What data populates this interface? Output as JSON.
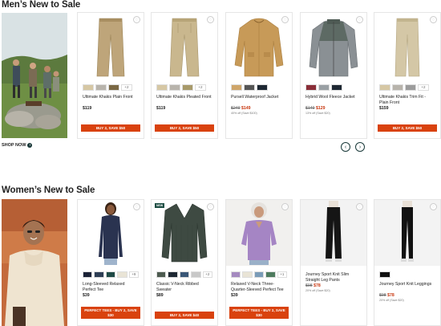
{
  "men": {
    "title": "Men’s New to Sale",
    "shop_now": "SHOP NOW",
    "products": [
      {
        "name": "Ultimate Khakis Plain Front",
        "price": "$119",
        "old_price": "",
        "new_price": "",
        "savings": "",
        "swatch_more": "+2",
        "promo": "BUY 2, SAVE $50",
        "swatches": [
          "#d6c7a4",
          "#b8b4ac",
          "#7a6844"
        ]
      },
      {
        "name": "Ultimate Khakis Pleated Front",
        "price": "$119",
        "old_price": "",
        "new_price": "",
        "savings": "",
        "swatch_more": "+2",
        "promo": "BUY 2, SAVE $50",
        "swatches": [
          "#d6c7a4",
          "#b8b4ac",
          "#a89a6a"
        ]
      },
      {
        "name": "Pursell Waterproof Jacket",
        "price": "",
        "old_price": "$249",
        "new_price": "$149",
        "savings": "40% off (Save $100)",
        "swatch_more": "",
        "promo": "",
        "swatches": [
          "#cfa66a",
          "#565656",
          "#1e2833"
        ]
      },
      {
        "name": "Hybrid Wool Fleece Jacket",
        "price": "",
        "old_price": "$149",
        "new_price": "$129",
        "savings": "13% off (Save $20)",
        "swatch_more": "",
        "promo": "",
        "swatches": [
          "#8a2e38",
          "#9aa0a4",
          "#1e2833"
        ]
      },
      {
        "name": "Ultimate Khakis Trim Fit - Plain Front",
        "price": "$159",
        "old_price": "",
        "new_price": "",
        "savings": "",
        "swatch_more": "+2",
        "promo": "BUY 2, SAVE $50",
        "swatches": [
          "#d6c7a4",
          "#b8b4ac",
          "#9c9c9c"
        ]
      }
    ]
  },
  "women": {
    "title": "Women’s New to Sale",
    "new_badge": "NEW",
    "products": [
      {
        "name": "Long-Sleeved Relaxed Perfect Tee",
        "price": "$39",
        "old_price": "",
        "new_price": "",
        "savings": "",
        "swatch_more": "+9",
        "promo": "PERFECT TEES - BUY 2, SAVE $30",
        "swatches": [
          "#1b2237",
          "#2e3e55",
          "#1f4a46",
          "#e9e4d6"
        ]
      },
      {
        "name": "Classic V-Neck Ribbed Sweater",
        "price": "$89",
        "old_price": "",
        "new_price": "",
        "savings": "",
        "swatch_more": "+2",
        "promo": "BUY 2, SAVE $40",
        "swatches": [
          "#4d5b50",
          "#1e2833",
          "#3a5777",
          "#c8c8c8"
        ]
      },
      {
        "name": "Relaxed V-Neck Three-Quarter-Sleeved Perfect Tee",
        "price": "$39",
        "old_price": "",
        "new_price": "",
        "savings": "",
        "swatch_more": "+1",
        "promo": "PERFECT TEES - BUY 2, SAVE $30",
        "swatches": [
          "#a58ac0",
          "#e9e4d6",
          "#7a9bb8",
          "#4e7b5e"
        ]
      },
      {
        "name": "Journey Sport Knit Slim Straight Leg Pants",
        "price": "",
        "old_price": "$98",
        "new_price": "$78",
        "savings": "20% off (Save $20)",
        "swatch_more": "",
        "promo": "",
        "swatches": []
      },
      {
        "name": "Journey Sport Knit Leggings",
        "price": "",
        "old_price": "$98",
        "new_price": "$78",
        "savings": "20% off (Save $20)",
        "swatch_more": "",
        "promo": "",
        "swatches": [
          "#111111"
        ]
      }
    ]
  },
  "carousel": {
    "prev": "‹",
    "next": "›"
  },
  "colors": {
    "promo": "#d9420e",
    "sale_price": "#c8370f",
    "nav": "#1a3a3a",
    "new_badge": "#1f4f45"
  }
}
